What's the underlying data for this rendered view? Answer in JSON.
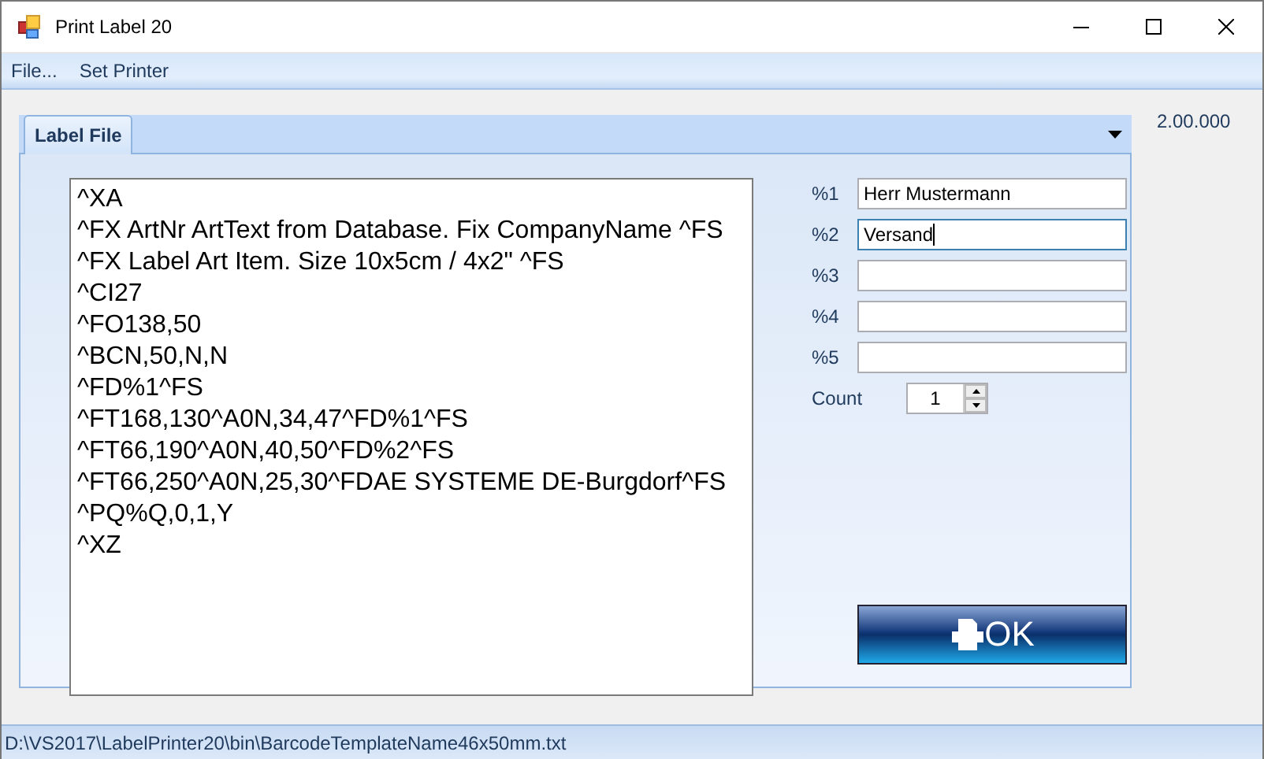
{
  "window": {
    "title": "Print Label 20"
  },
  "menu": [
    "File...",
    "Set Printer"
  ],
  "tabs": [
    {
      "label": "Label File",
      "selected": true
    }
  ],
  "version": "2.00.000",
  "editor": {
    "lines": [
      "^XA",
      "^FX ArtNr ArtText from Database. Fix CompanyName ^FS",
      "^FX Label Art Item. Size 10x5cm / 4x2\" ^FS",
      "^CI27",
      "^FO138,50",
      "^BCN,50,N,N",
      "^FD%1^FS",
      "^FT168,130^A0N,34,47^FD%1^FS",
      "^FT66,190^A0N,40,50^FD%2^FS",
      "^FT66,250^A0N,25,30^FDAE SYSTEME DE-Burgdorf^FS",
      "^PQ%Q,0,1,Y",
      "^XZ"
    ]
  },
  "fields": [
    {
      "label": "%1",
      "value": "Herr Mustermann",
      "focused": false
    },
    {
      "label": "%2",
      "value": "Versand",
      "focused": true
    },
    {
      "label": "%3",
      "focused": false
    },
    {
      "label": "%4",
      "focused": false
    },
    {
      "label": "%5",
      "focused": false
    }
  ],
  "count": {
    "label": "Count",
    "value": "1"
  },
  "ok_button": {
    "label": "OK"
  },
  "status_bar": "D:\\VS2017\\LabelPrinter20\\bin\\BarcodeTemplateName46x50mm.txt"
}
